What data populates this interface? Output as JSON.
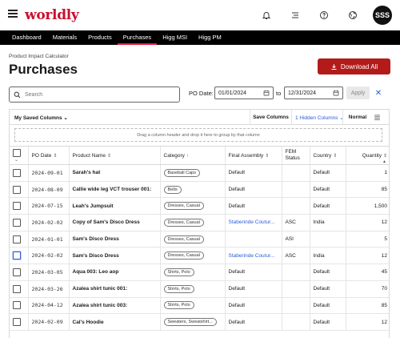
{
  "app": {
    "logo": "worldly",
    "avatar_initials": "SSS"
  },
  "nav": {
    "items": [
      {
        "label": "Dashboard",
        "active": false
      },
      {
        "label": "Materials",
        "active": false
      },
      {
        "label": "Products",
        "active": false
      },
      {
        "label": "Purchases",
        "active": true
      },
      {
        "label": "Higg MSI",
        "active": false
      },
      {
        "label": "Higg PM",
        "active": false
      }
    ]
  },
  "page": {
    "breadcrumb": "Product Impact Calculator",
    "title": "Purchases",
    "download_label": "Download All"
  },
  "filters": {
    "search_placeholder": "Search",
    "po_date_label": "PO Date:",
    "date_from": "01/01/2024",
    "to_label": "to",
    "date_to": "12/31/2024",
    "apply_label": "Apply"
  },
  "toolbar": {
    "saved_columns": "My Saved Columns",
    "save_columns": "Save Columns",
    "hidden_columns": "1 Hidden Columns",
    "density": "Normal"
  },
  "grid": {
    "group_hint": "Drag a column header and drop it here to group by that column",
    "columns": [
      "PO Date",
      "Product Name",
      "Category",
      "Final Assembly",
      "FEM Status",
      "Country",
      "Quantity"
    ],
    "rows": [
      {
        "date": "2024-09-01",
        "name": "Sarah's hat",
        "category": "Baseball Caps",
        "assembly": "Default",
        "assembly_link": false,
        "fem": "",
        "country": "Default",
        "qty": "1"
      },
      {
        "date": "2024-08-09",
        "name": "Callie wide leg VCT trouser 001:",
        "category": "Belts",
        "assembly": "Default",
        "assembly_link": false,
        "fem": "",
        "country": "Default",
        "qty": "85"
      },
      {
        "date": "2024-07-15",
        "name": "Leah's Jumpsuit",
        "category": "Dresses, Casual",
        "assembly": "Default",
        "assembly_link": false,
        "fem": "",
        "country": "Default",
        "qty": "1,500"
      },
      {
        "date": "2024-02-02",
        "name": "Copy of Sam's Disco Dress",
        "category": "Dresses, Casual",
        "assembly": "Staberinde Coutur...",
        "assembly_link": true,
        "fem": "ASC",
        "country": "India",
        "qty": "12"
      },
      {
        "date": "2024-01-01",
        "name": "Sam's Disco Dress",
        "category": "Dresses, Casual",
        "assembly": "",
        "assembly_link": false,
        "fem": "ASI",
        "country": "",
        "qty": "5"
      },
      {
        "date": "2024-02-02",
        "name": "Sam's Disco Dress",
        "category": "Dresses, Casual",
        "assembly": "Staberinde Coutur...",
        "assembly_link": true,
        "fem": "ASC",
        "country": "India",
        "qty": "12"
      },
      {
        "date": "2024-03-05",
        "name": "Aqua 003: Leo aop",
        "category": "Shirts, Polo",
        "assembly": "Default",
        "assembly_link": false,
        "fem": "",
        "country": "Default",
        "qty": "45"
      },
      {
        "date": "2024-03-26",
        "name": "Azalea shirt tunic 001:",
        "category": "Shirts, Polo",
        "assembly": "Default",
        "assembly_link": false,
        "fem": "",
        "country": "Default",
        "qty": "70"
      },
      {
        "date": "2024-04-12",
        "name": "Azalea shirt tunic 003:",
        "category": "Shirts, Polo",
        "assembly": "Default",
        "assembly_link": false,
        "fem": "",
        "country": "Default",
        "qty": "85"
      },
      {
        "date": "2024-02-09",
        "name": "Cal's Hoodie",
        "category": "Sweaters, Sweatshirt...",
        "assembly": "Default",
        "assembly_link": false,
        "fem": "",
        "country": "Default",
        "qty": "12"
      }
    ]
  }
}
